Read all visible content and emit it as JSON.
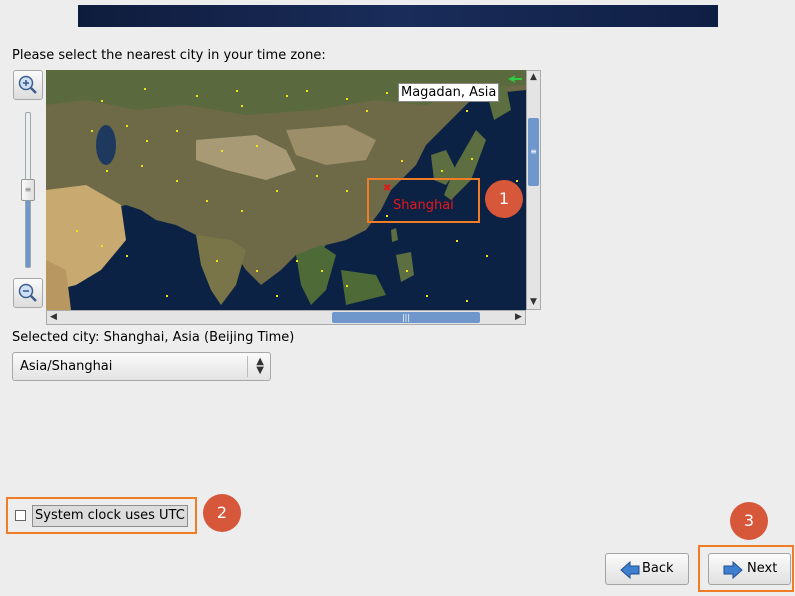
{
  "prompt": "Please select the nearest city in your time zone:",
  "map": {
    "hover_label": "Magadan, Asia",
    "selected_marker_label": "Shanghai"
  },
  "selected_city_text": "Selected city: Shanghai, Asia (Beijing Time)",
  "timezone_select": {
    "value": "Asia/Shanghai"
  },
  "utc_checkbox": {
    "label": "System clock uses UTC",
    "checked": false
  },
  "buttons": {
    "back": "Back",
    "next": "Next"
  },
  "annotations": [
    "1",
    "2",
    "3"
  ],
  "colors": {
    "highlight": "#f07d26",
    "badge": "#d7573a",
    "marker": "#e8161a",
    "accent": "#6f97cc"
  }
}
